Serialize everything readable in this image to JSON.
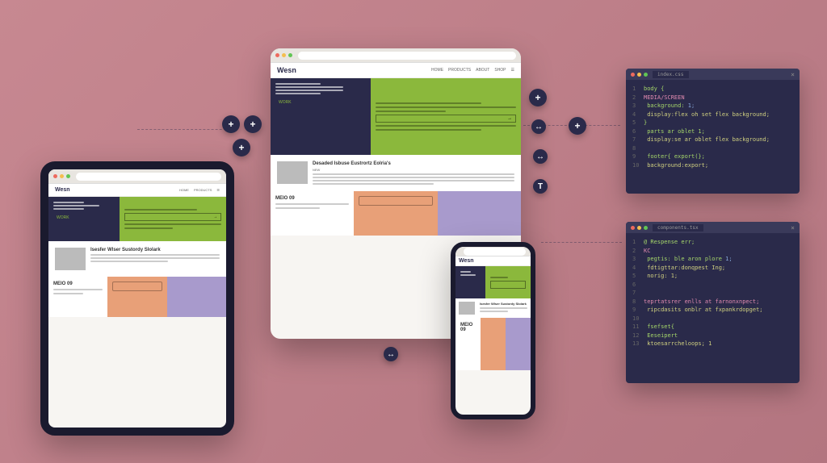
{
  "site": {
    "logo": "Wesn",
    "nav": [
      "HOME",
      "PRODUCTS",
      "ABOUT",
      "SHOP",
      "☰"
    ]
  },
  "hero": {
    "badge": "WORK"
  },
  "article": {
    "title_desktop": "Desaded Isbuse Eustrortz Eolria's",
    "subtitle": "NEW",
    "title_tablet": "Isesfer Wlser Sustordy Slolark"
  },
  "panels": {
    "title": "MEIO 09"
  },
  "code1": {
    "tab": "index.css",
    "lines": [
      {
        "ln": "1",
        "txt": "body {",
        "cls": "kw"
      },
      {
        "ln": "2",
        "txt": "MEDIA/SCREEN",
        "cls": "pk"
      },
      {
        "ln": "3",
        "txt": " background:",
        "cls": "kw",
        "post": " 1;"
      },
      {
        "ln": "4",
        "txt": "  display:flex oh set flex background;",
        "cls": "str"
      },
      {
        "ln": "5",
        "txt": "}",
        "cls": "kw"
      },
      {
        "ln": "6",
        "txt": "  parts ar oblet 1;",
        "cls": "kw"
      },
      {
        "ln": "7",
        "txt": "  display:se ar oblet flex background;",
        "cls": "str"
      },
      {
        "ln": "8",
        "txt": "",
        "cls": ""
      },
      {
        "ln": "9",
        "txt": "  footer{ export(};",
        "cls": "kw"
      },
      {
        "ln": "10",
        "txt": "    background:export;",
        "cls": "str"
      }
    ]
  },
  "code2": {
    "tab": "components.tsx",
    "lines": [
      {
        "ln": "1",
        "txt": "@ Respense err;",
        "cls": "kw"
      },
      {
        "ln": "2",
        "txt": "KC",
        "cls": "pk"
      },
      {
        "ln": "3",
        "txt": " pegtis: ble aron plore",
        "cls": "kw",
        "post": " 1;"
      },
      {
        "ln": "4",
        "txt": "  fdtigttar:donqpest Ing;",
        "cls": "str"
      },
      {
        "ln": "5",
        "txt": "  norig: 1;",
        "cls": "str"
      },
      {
        "ln": "6",
        "txt": "",
        "cls": ""
      },
      {
        "ln": "7",
        "txt": "",
        "cls": ""
      },
      {
        "ln": "8",
        "txt": "teprtatsrer enlls at farnonxnpect;",
        "cls": "pk"
      },
      {
        "ln": "9",
        "txt": " ripcdasits onblr at fxpankrdopget;",
        "cls": "str"
      },
      {
        "ln": "10",
        "txt": "",
        "cls": ""
      },
      {
        "ln": "11",
        "txt": "  fsefset{",
        "cls": "kw"
      },
      {
        "ln": "12",
        "txt": "  Eeseipert",
        "cls": "kw"
      },
      {
        "ln": "13",
        "txt": "    ktoesarrcheloops; 1",
        "cls": "str"
      }
    ]
  },
  "icons": {
    "plus": "+",
    "move": "↔",
    "text": "T"
  }
}
